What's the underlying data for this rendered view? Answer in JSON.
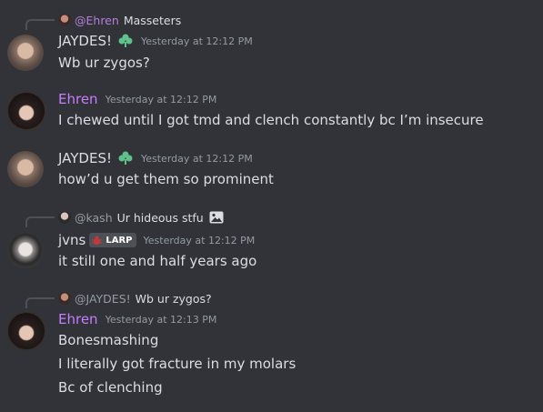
{
  "colors": {
    "background": "#313338",
    "jaydes_name": "#dbdee1",
    "ehren_name": "#c77dff",
    "jvns_name": "#dbdee1",
    "reply_mention": "#b57edc",
    "reply_mention_muted": "#949ba4",
    "timestamp": "#949ba4",
    "role_icon_green": "#5ec28a"
  },
  "messages": [
    {
      "reply": {
        "author": "@Ehren",
        "text": "Masseters"
      },
      "author": "JAYDES!",
      "timestamp": "Yesterday at 12:12 PM",
      "lines": [
        "Wb ur zygos?"
      ]
    },
    {
      "author": "Ehren",
      "timestamp": "Yesterday at 12:12 PM",
      "lines": [
        "I chewed until I got tmd and clench constantly bc I’m insecure"
      ]
    },
    {
      "author": "JAYDES!",
      "timestamp": "Yesterday at 12:12 PM",
      "lines": [
        "how’d u get them so prominent"
      ]
    },
    {
      "reply": {
        "author": "@kash",
        "text": "Ur hideous stfu"
      },
      "author": "jvns",
      "tag": "LARP",
      "timestamp": "Yesterday at 12:12 PM",
      "lines": [
        "it still one and half years ago"
      ]
    },
    {
      "reply": {
        "author": "@JAYDES!",
        "text": "Wb ur zygos?"
      },
      "author": "Ehren",
      "timestamp": "Yesterday at 12:13 PM",
      "lines": [
        "Bonesmashing",
        "I literally got fracture in my molars",
        "Bc of clenching"
      ]
    }
  ]
}
